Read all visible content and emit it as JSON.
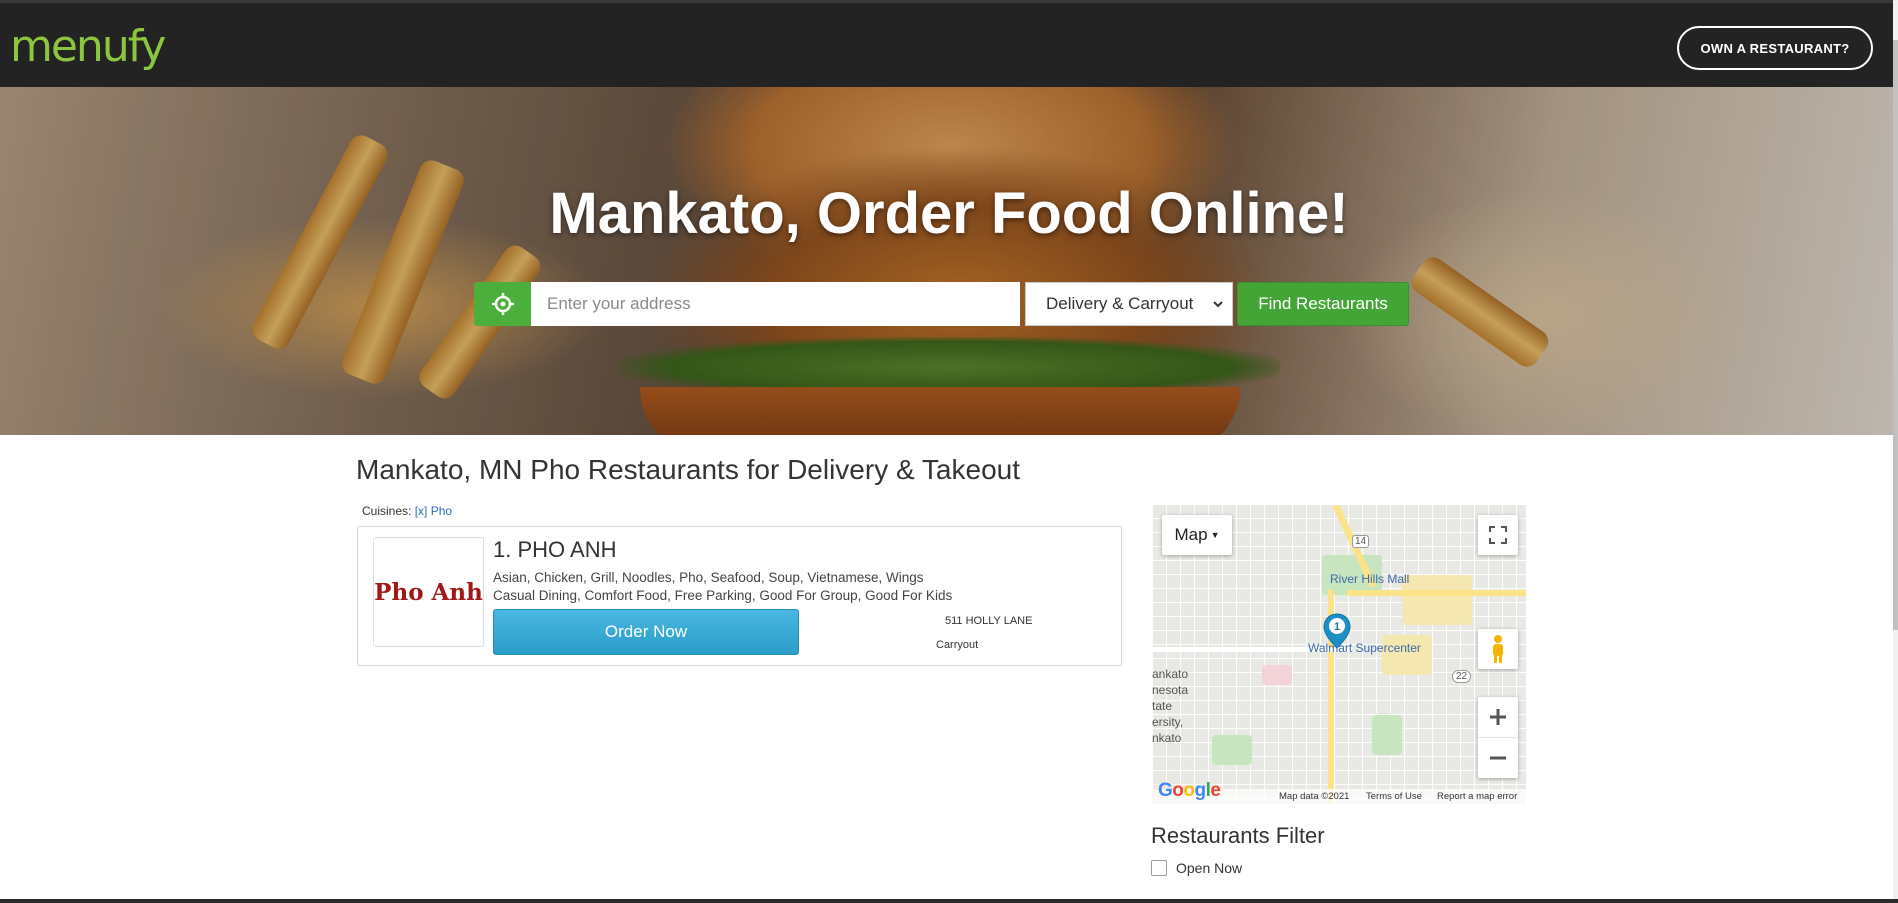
{
  "header": {
    "logo_text": "menufy",
    "own_restaurant_label": "OWN A RESTAURANT?"
  },
  "hero": {
    "title": "Mankato, Order Food Online!",
    "address_placeholder": "Enter your address",
    "mode_selected": "Delivery & Carryout",
    "find_label": "Find Restaurants",
    "locate_icon": "crosshair-icon"
  },
  "main": {
    "heading": "Mankato, MN Pho Restaurants for Delivery & Takeout",
    "cuisines_label": "Cuisines:",
    "cuisine_filter": "[x] Pho"
  },
  "restaurants": [
    {
      "logo_text": "Pho Anh",
      "title": "1. PHO ANH",
      "cuisines": "Asian, Chicken, Grill, Noodles, Pho, Seafood, Soup, Vietnamese, Wings",
      "features": "Casual Dining, Comfort Food, Free Parking, Good For Group, Good For Kids",
      "order_label": "Order Now",
      "address": "511 HOLLY LANE",
      "mode": "Carryout"
    }
  ],
  "map": {
    "type_label": "Map",
    "marker_number": "1",
    "labels": {
      "mall": "River Hills Mall",
      "store": "Walmart Supercenter",
      "hwy14": "14",
      "hwy22": "22",
      "city1": "ankato",
      "city2": "nesota",
      "city3": "tate",
      "city4": "ersity,",
      "city5": "nkato"
    },
    "footer": {
      "logo": "Google",
      "data": "Map data ©2021",
      "terms": "Terms of Use",
      "report": "Report a map error"
    }
  },
  "filter": {
    "title": "Restaurants Filter",
    "open_now_label": "Open Now"
  },
  "colors": {
    "brand_green": "#8cc63e",
    "find_green": "#43a536",
    "order_blue": "#2a9dc9",
    "link_blue": "#2a6fb5"
  }
}
